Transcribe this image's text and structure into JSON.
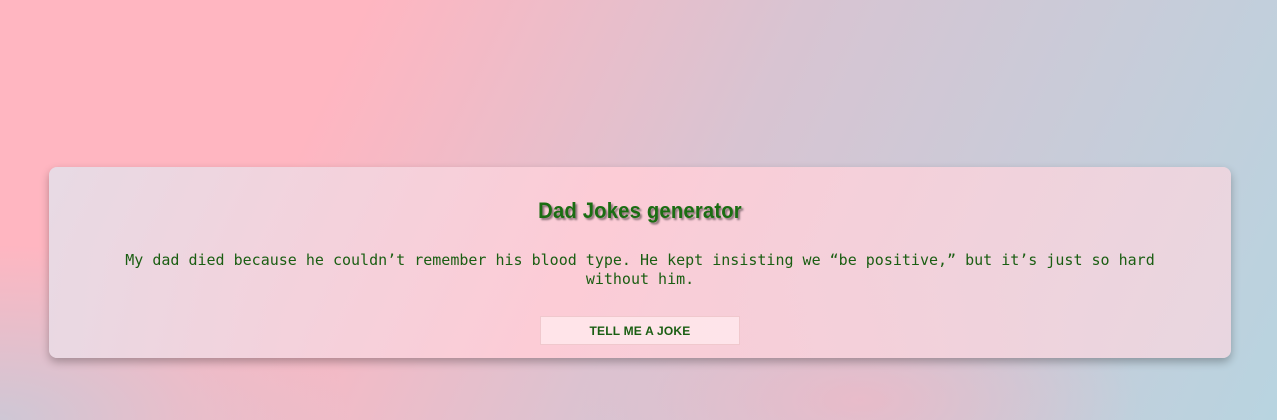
{
  "app": {
    "title": "Dad Jokes generator"
  },
  "joke": {
    "text": "My dad died because he couldn’t remember his blood type. He kept insisting we “be positive,” but it’s just so hard without him."
  },
  "actions": {
    "button_label": "TELL ME A JOKE"
  },
  "colors": {
    "text": "#1a5e12",
    "background_pink": "#ffb6c1",
    "background_blue": "#b8d4e0"
  }
}
